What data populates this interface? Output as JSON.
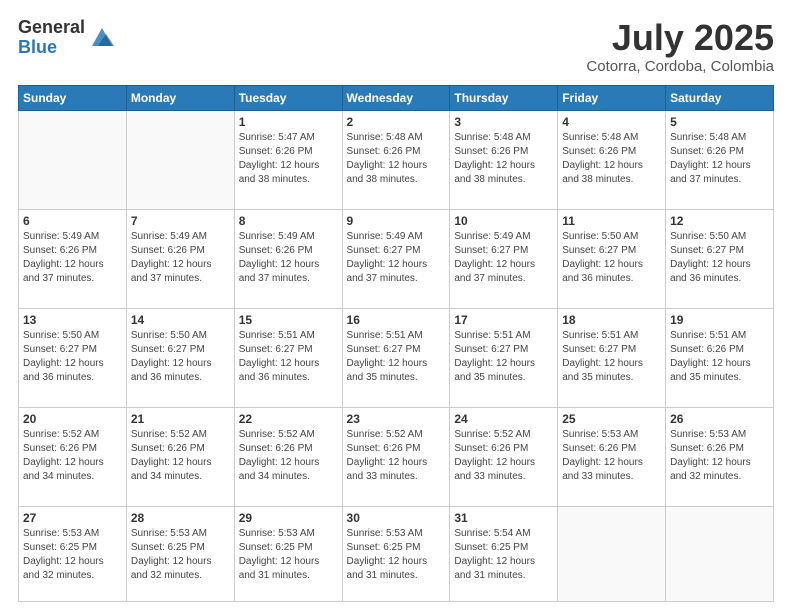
{
  "header": {
    "logo_general": "General",
    "logo_blue": "Blue",
    "month_year": "July 2025",
    "location": "Cotorra, Cordoba, Colombia"
  },
  "days_of_week": [
    "Sunday",
    "Monday",
    "Tuesday",
    "Wednesday",
    "Thursday",
    "Friday",
    "Saturday"
  ],
  "weeks": [
    [
      {
        "day": "",
        "info": ""
      },
      {
        "day": "",
        "info": ""
      },
      {
        "day": "1",
        "sunrise": "5:47 AM",
        "sunset": "6:26 PM",
        "daylight": "12 hours and 38 minutes."
      },
      {
        "day": "2",
        "sunrise": "5:48 AM",
        "sunset": "6:26 PM",
        "daylight": "12 hours and 38 minutes."
      },
      {
        "day": "3",
        "sunrise": "5:48 AM",
        "sunset": "6:26 PM",
        "daylight": "12 hours and 38 minutes."
      },
      {
        "day": "4",
        "sunrise": "5:48 AM",
        "sunset": "6:26 PM",
        "daylight": "12 hours and 38 minutes."
      },
      {
        "day": "5",
        "sunrise": "5:48 AM",
        "sunset": "6:26 PM",
        "daylight": "12 hours and 37 minutes."
      }
    ],
    [
      {
        "day": "6",
        "sunrise": "5:49 AM",
        "sunset": "6:26 PM",
        "daylight": "12 hours and 37 minutes."
      },
      {
        "day": "7",
        "sunrise": "5:49 AM",
        "sunset": "6:26 PM",
        "daylight": "12 hours and 37 minutes."
      },
      {
        "day": "8",
        "sunrise": "5:49 AM",
        "sunset": "6:26 PM",
        "daylight": "12 hours and 37 minutes."
      },
      {
        "day": "9",
        "sunrise": "5:49 AM",
        "sunset": "6:27 PM",
        "daylight": "12 hours and 37 minutes."
      },
      {
        "day": "10",
        "sunrise": "5:49 AM",
        "sunset": "6:27 PM",
        "daylight": "12 hours and 37 minutes."
      },
      {
        "day": "11",
        "sunrise": "5:50 AM",
        "sunset": "6:27 PM",
        "daylight": "12 hours and 36 minutes."
      },
      {
        "day": "12",
        "sunrise": "5:50 AM",
        "sunset": "6:27 PM",
        "daylight": "12 hours and 36 minutes."
      }
    ],
    [
      {
        "day": "13",
        "sunrise": "5:50 AM",
        "sunset": "6:27 PM",
        "daylight": "12 hours and 36 minutes."
      },
      {
        "day": "14",
        "sunrise": "5:50 AM",
        "sunset": "6:27 PM",
        "daylight": "12 hours and 36 minutes."
      },
      {
        "day": "15",
        "sunrise": "5:51 AM",
        "sunset": "6:27 PM",
        "daylight": "12 hours and 36 minutes."
      },
      {
        "day": "16",
        "sunrise": "5:51 AM",
        "sunset": "6:27 PM",
        "daylight": "12 hours and 35 minutes."
      },
      {
        "day": "17",
        "sunrise": "5:51 AM",
        "sunset": "6:27 PM",
        "daylight": "12 hours and 35 minutes."
      },
      {
        "day": "18",
        "sunrise": "5:51 AM",
        "sunset": "6:27 PM",
        "daylight": "12 hours and 35 minutes."
      },
      {
        "day": "19",
        "sunrise": "5:51 AM",
        "sunset": "6:26 PM",
        "daylight": "12 hours and 35 minutes."
      }
    ],
    [
      {
        "day": "20",
        "sunrise": "5:52 AM",
        "sunset": "6:26 PM",
        "daylight": "12 hours and 34 minutes."
      },
      {
        "day": "21",
        "sunrise": "5:52 AM",
        "sunset": "6:26 PM",
        "daylight": "12 hours and 34 minutes."
      },
      {
        "day": "22",
        "sunrise": "5:52 AM",
        "sunset": "6:26 PM",
        "daylight": "12 hours and 34 minutes."
      },
      {
        "day": "23",
        "sunrise": "5:52 AM",
        "sunset": "6:26 PM",
        "daylight": "12 hours and 33 minutes."
      },
      {
        "day": "24",
        "sunrise": "5:52 AM",
        "sunset": "6:26 PM",
        "daylight": "12 hours and 33 minutes."
      },
      {
        "day": "25",
        "sunrise": "5:53 AM",
        "sunset": "6:26 PM",
        "daylight": "12 hours and 33 minutes."
      },
      {
        "day": "26",
        "sunrise": "5:53 AM",
        "sunset": "6:26 PM",
        "daylight": "12 hours and 32 minutes."
      }
    ],
    [
      {
        "day": "27",
        "sunrise": "5:53 AM",
        "sunset": "6:25 PM",
        "daylight": "12 hours and 32 minutes."
      },
      {
        "day": "28",
        "sunrise": "5:53 AM",
        "sunset": "6:25 PM",
        "daylight": "12 hours and 32 minutes."
      },
      {
        "day": "29",
        "sunrise": "5:53 AM",
        "sunset": "6:25 PM",
        "daylight": "12 hours and 31 minutes."
      },
      {
        "day": "30",
        "sunrise": "5:53 AM",
        "sunset": "6:25 PM",
        "daylight": "12 hours and 31 minutes."
      },
      {
        "day": "31",
        "sunrise": "5:54 AM",
        "sunset": "6:25 PM",
        "daylight": "12 hours and 31 minutes."
      },
      {
        "day": "",
        "info": ""
      },
      {
        "day": "",
        "info": ""
      }
    ]
  ],
  "labels": {
    "sunrise_prefix": "Sunrise: ",
    "sunset_prefix": "Sunset: ",
    "daylight_prefix": "Daylight: "
  }
}
